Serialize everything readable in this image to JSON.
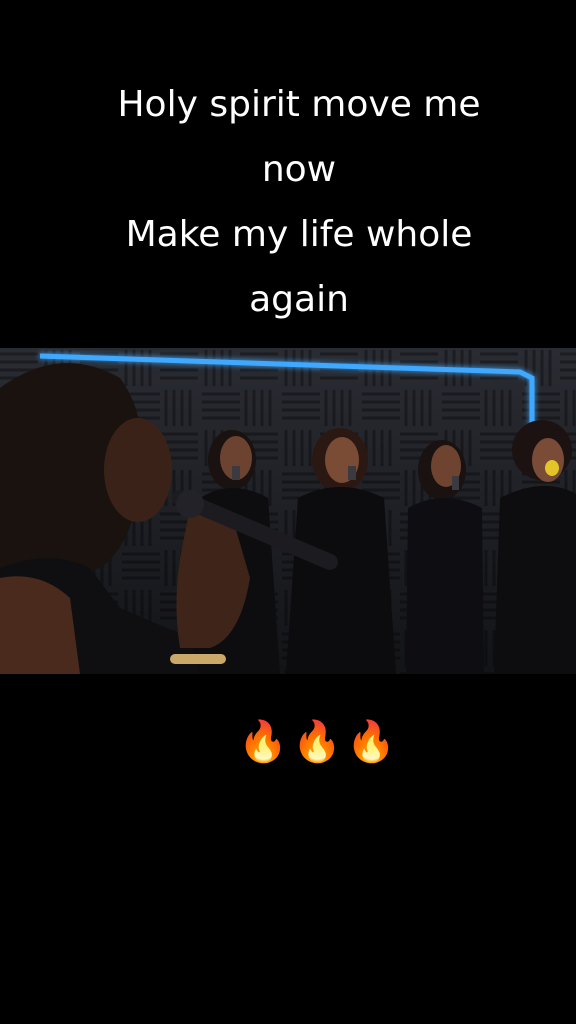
{
  "caption": {
    "lines": [
      "Holy spirit move me",
      "now",
      "Make my life whole",
      "again"
    ]
  },
  "video": {
    "description_icon": "video-frame"
  },
  "emojis": [
    "😭",
    "😭",
    "😭",
    "🔥",
    "🔥",
    "🔥",
    "😭",
    "😭"
  ],
  "colors": {
    "background": "#000000",
    "neon": "#3fa9ff",
    "text": "#ffffff"
  }
}
